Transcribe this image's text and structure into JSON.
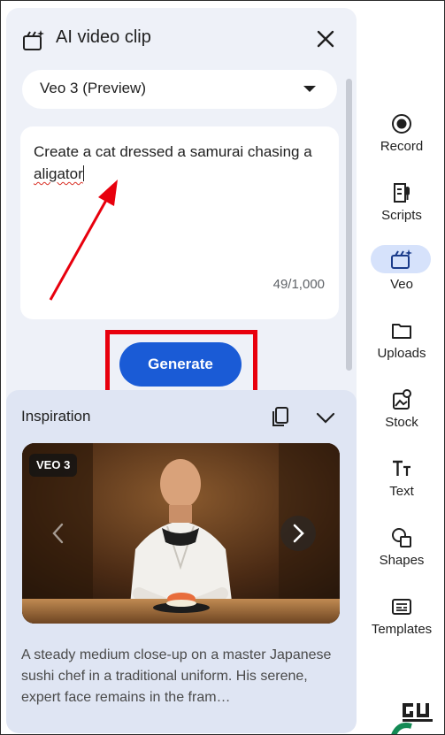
{
  "panel": {
    "title": "AI video clip",
    "model_select": {
      "selected": "Veo 3 (Preview)"
    },
    "prompt": {
      "text_before": "Create a cat dressed a samurai chasing a ",
      "text_misspelled": "aligator",
      "char_count": "49/1,000"
    },
    "generate_label": "Generate",
    "inspiration": {
      "title": "Inspiration",
      "badge": "VEO 3",
      "description": "A steady medium close-up on a master Japanese sushi chef in a traditional uniform. His serene, expert face remains in the fram…"
    }
  },
  "rail": {
    "items": [
      {
        "label": "Record",
        "icon": "record-icon"
      },
      {
        "label": "Scripts",
        "icon": "scripts-icon"
      },
      {
        "label": "Veo",
        "icon": "veo-icon",
        "active": true
      },
      {
        "label": "Uploads",
        "icon": "folder-icon"
      },
      {
        "label": "Stock",
        "icon": "stock-icon"
      },
      {
        "label": "Text",
        "icon": "text-icon"
      },
      {
        "label": "Shapes",
        "icon": "shapes-icon"
      },
      {
        "label": "Templates",
        "icon": "templates-icon"
      }
    ]
  },
  "colors": {
    "panel_bg": "#eef1f8",
    "inspiration_bg": "#dfe5f3",
    "accent": "#1a5bd6",
    "annotation_red": "#e8000d",
    "veo_active_bg": "#d6e2fb"
  }
}
